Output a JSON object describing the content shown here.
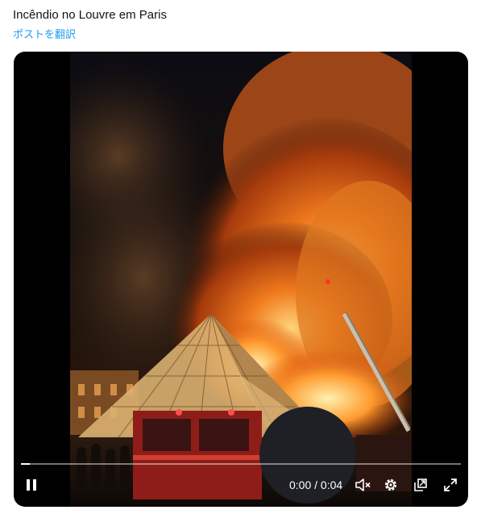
{
  "post": {
    "text": "Incêndio no Louvre em Paris",
    "translate_label": "ポストを翻訳"
  },
  "player": {
    "progress_fraction": 0.02,
    "current_time": "0:00",
    "separator": "/",
    "duration": "0:04",
    "icons": {
      "pause": "pause-icon",
      "mute": "volume-muted-icon",
      "settings": "gear-icon",
      "pop_out": "pop-out-icon",
      "fullscreen": "fullscreen-icon"
    }
  },
  "colors": {
    "link": "#1d9bf0",
    "text": "#0f1419",
    "player_bg": "#000000"
  }
}
